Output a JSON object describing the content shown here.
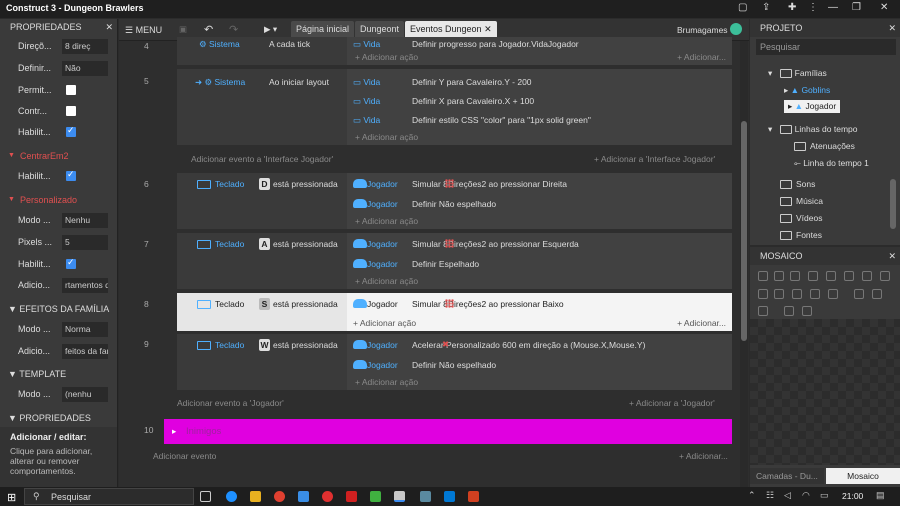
{
  "window": {
    "title": "Construct 3 - Dungeon Brawlers"
  },
  "toolbar": {
    "menu_label": "MENU",
    "tabs": [
      "Página inicial",
      "Dungeont",
      "Eventos Dungeon"
    ],
    "user": "Brumagames"
  },
  "properties": {
    "header": "PROPRIEDADES",
    "rows": [
      {
        "label": "Direçõ...",
        "value": "8 direç"
      },
      {
        "label": "Definir...",
        "value": "Não"
      },
      {
        "label": "Permit...",
        "value": ""
      },
      {
        "label": "Contr...",
        "value": ""
      },
      {
        "label": "Habilit...",
        "value": ""
      }
    ],
    "centrar_section": "CentrarEm2",
    "centrar_row": {
      "label": "Habilit..."
    },
    "personalizado_section": "Personalizado",
    "pers_rows": [
      {
        "label": "Modo ...",
        "value": "Nenhu"
      },
      {
        "label": "Pixels ...",
        "value": "5"
      },
      {
        "label": "Habilit...",
        "value": ""
      },
      {
        "label": "Adicio...",
        "value": "rtamentos d"
      }
    ],
    "efeitos_header": "EFEITOS DA FAMÍLIA",
    "efeitos_rows": [
      {
        "label": "Modo ...",
        "value": "Norma"
      },
      {
        "label": "Adicio...",
        "value": "feitos da fam"
      }
    ],
    "template_header": "TEMPLATE",
    "template_row": {
      "label": "Modo ...",
      "value": "(nenhu"
    },
    "props2_header": "PROPRIEDADES",
    "help_title": "Adicionar / editar:",
    "help_text": "Clique para adicionar, alterar ou remover comportamentos."
  },
  "events": {
    "e4": {
      "num": "4",
      "obj": "Sistema",
      "cond": "A cada tick",
      "act_obj": "Vida",
      "act": "Definir progresso para Jogador.VidaJogador"
    },
    "e5": {
      "num": "5",
      "obj": "Sistema",
      "cond": "Ao iniciar layout",
      "acts": [
        {
          "obj": "Vida",
          "text": "Definir Y para Cavaleiro.Y - 200"
        },
        {
          "obj": "Vida",
          "text": "Definir X para Cavaleiro.X + 100"
        },
        {
          "obj": "Vida",
          "text": "Definir estilo CSS \"color\" para \"1px solid green\""
        }
      ]
    },
    "add_action": "+ Adicionar ação",
    "add_action_short": "+ Adicionar...",
    "add_event_interface": "Adicionar evento a 'Interface Jogador'",
    "add_interface": "+ Adicionar a 'Interface Jogador'",
    "e6": {
      "num": "6",
      "obj": "Teclado",
      "key": "D",
      "cond": "está pressionada",
      "acts": [
        {
          "obj": "Jogador",
          "text": "Simular  8Direções2 ao pressionar Direita"
        },
        {
          "obj": "Jogador",
          "text": "Definir Não espelhado"
        }
      ]
    },
    "e7": {
      "num": "7",
      "obj": "Teclado",
      "key": "A",
      "cond": "está pressionada",
      "acts": [
        {
          "obj": "Jogador",
          "text": "Simular  8Direções2 ao pressionar Esquerda"
        },
        {
          "obj": "Jogador",
          "text": "Definir Espelhado"
        }
      ]
    },
    "e8": {
      "num": "8",
      "obj": "Teclado",
      "key": "S",
      "cond": "está pressionada",
      "acts": [
        {
          "obj": "Jogador",
          "text": "Simular  8Direções2 ao pressionar Baixo"
        }
      ]
    },
    "e9": {
      "num": "9",
      "obj": "Teclado",
      "key": "W",
      "cond": "está pressionada",
      "acts": [
        {
          "obj": "Jogador",
          "text": "Acelerar  Personalizado 600 em direção a (Mouse.X,Mouse.Y)"
        },
        {
          "obj": "Jogador",
          "text": "Definir Não espelhado"
        }
      ]
    },
    "add_event_jogador": "Adicionar evento a 'Jogador'",
    "add_jogador": "+ Adicionar a 'Jogador'",
    "group_num": "10",
    "group_name": "Inimigos",
    "add_event": "Adicionar evento",
    "add_short": "+ Adicionar..."
  },
  "project": {
    "header": "PROJETO",
    "search_placeholder": "Pesquisar",
    "items": [
      "Famílias",
      "Goblins",
      "Jogador",
      "Linhas do tempo",
      "Atenuações",
      "Linha do tempo 1",
      "Sons",
      "Música",
      "Vídeos",
      "Fontes"
    ]
  },
  "mosaic": {
    "header": "MOSAICO",
    "tabs": [
      "Camadas - Du...",
      "Mosaico"
    ]
  },
  "taskbar": {
    "search": "Pesquisar",
    "time": "21:00"
  },
  "colors": {
    "accent": "#4fb0ff",
    "group": "#e000e0",
    "section_red": "#e05050"
  }
}
